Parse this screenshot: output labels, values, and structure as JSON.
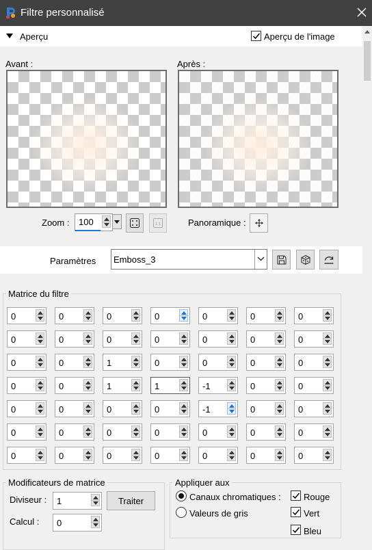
{
  "window": {
    "title": "Filtre personnalisé",
    "app_icon": "paintshop-logo-icon",
    "close_icon": "close-icon"
  },
  "apercu": {
    "section_label": "Aperçu",
    "show_preview_label": "Aperçu de l'image",
    "show_preview_checked": true
  },
  "preview": {
    "before_label": "Avant :",
    "after_label": "Après :",
    "zoom_label": "Zoom :",
    "zoom_value": "100",
    "pan_label": "Panoramique :"
  },
  "params": {
    "label": "Paramètres",
    "preset_value": "Emboss_3"
  },
  "matrix": {
    "title": "Matrice du filtre",
    "rows": [
      [
        "0",
        "0",
        "0",
        "0",
        "0",
        "0",
        "0"
      ],
      [
        "0",
        "0",
        "0",
        "0",
        "0",
        "0",
        "0"
      ],
      [
        "0",
        "0",
        "1",
        "0",
        "0",
        "0",
        "0"
      ],
      [
        "0",
        "0",
        "1",
        "1",
        "-1",
        "0",
        "0"
      ],
      [
        "0",
        "0",
        "0",
        "0",
        "-1",
        "0",
        "0"
      ],
      [
        "0",
        "0",
        "0",
        "0",
        "0",
        "0",
        "0"
      ],
      [
        "0",
        "0",
        "0",
        "0",
        "0",
        "0",
        "0"
      ]
    ]
  },
  "modifiers": {
    "title": "Modificateurs de matrice",
    "divisor_label": "Diviseur :",
    "divisor_value": "1",
    "process_button": "Traiter",
    "calc_label": "Calcul :",
    "calc_value": "0"
  },
  "apply": {
    "title": "Appliquer aux",
    "color_channels_label": "Canaux chromatiques :",
    "color_channels_selected": true,
    "grey_values_label": "Valeurs de gris",
    "grey_values_selected": false,
    "red_label": "Rouge",
    "red_checked": true,
    "green_label": "Vert",
    "green_checked": true,
    "blue_label": "Bleu",
    "blue_checked": true
  }
}
